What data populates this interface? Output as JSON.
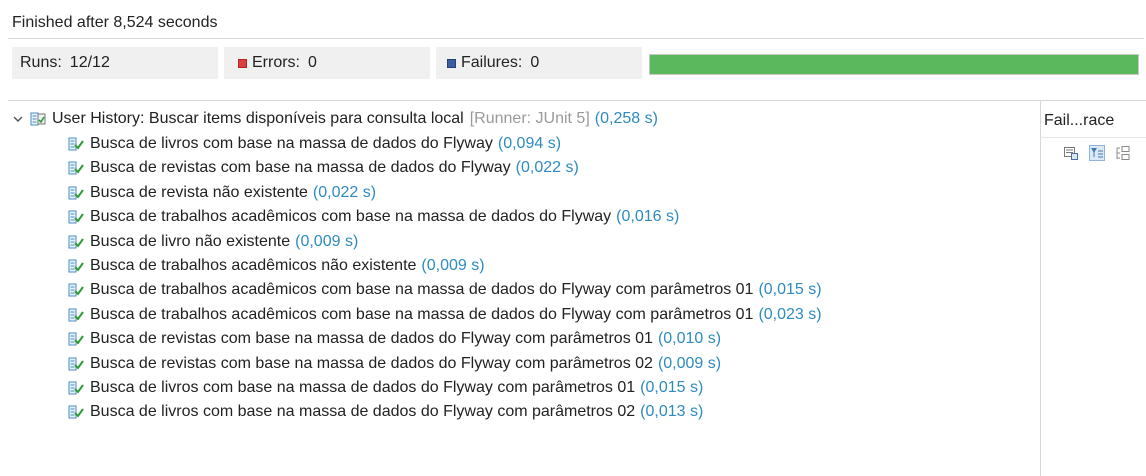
{
  "status_text": "Finished after 8,524 seconds",
  "counters": {
    "runs_label": "Runs:",
    "runs_value": "12/12",
    "errors_label": "Errors:",
    "errors_value": "0",
    "failures_label": "Failures:",
    "failures_value": "0"
  },
  "progress": {
    "fraction": 1.0,
    "color": "#5cb85c"
  },
  "tree": {
    "root": {
      "label": "User History: Buscar items disponíveis para consulta local",
      "runner": "[Runner: JUnit 5]",
      "time": "(0,258 s)"
    },
    "tests": [
      {
        "label": "Busca de livros com base na massa de dados do Flyway",
        "time": "(0,094 s)"
      },
      {
        "label": "Busca de revistas com base na massa de dados do Flyway",
        "time": "(0,022 s)"
      },
      {
        "label": "Busca de revista não existente",
        "time": "(0,022 s)"
      },
      {
        "label": "Busca de trabalhos acadêmicos com base na massa de dados do Flyway",
        "time": "(0,016 s)"
      },
      {
        "label": "Busca de livro não existente",
        "time": "(0,009 s)"
      },
      {
        "label": "Busca de trabalhos acadêmicos não existente",
        "time": "(0,009 s)"
      },
      {
        "label": "Busca de trabalhos acadêmicos com base na massa de dados do Flyway com parâmetros 01",
        "time": "(0,015 s)"
      },
      {
        "label": "Busca de trabalhos acadêmicos com base na massa de dados do Flyway com parâmetros 01",
        "time": "(0,023 s)"
      },
      {
        "label": "Busca de revistas com base na massa de dados do Flyway com parâmetros 01",
        "time": "(0,010 s)"
      },
      {
        "label": "Busca de revistas com base na massa de dados do Flyway com parâmetros 02",
        "time": "(0,009 s)"
      },
      {
        "label": "Busca de livros com base na massa de dados do Flyway com parâmetros 01",
        "time": "(0,015 s)"
      },
      {
        "label": "Busca de livros com base na massa de dados do Flyway com parâmetros 02",
        "time": "(0,013 s)"
      }
    ]
  },
  "trace": {
    "title": "Fail...race",
    "tools": [
      "compare-results-icon",
      "filter-stack-icon",
      "copy-trace-icon"
    ]
  }
}
